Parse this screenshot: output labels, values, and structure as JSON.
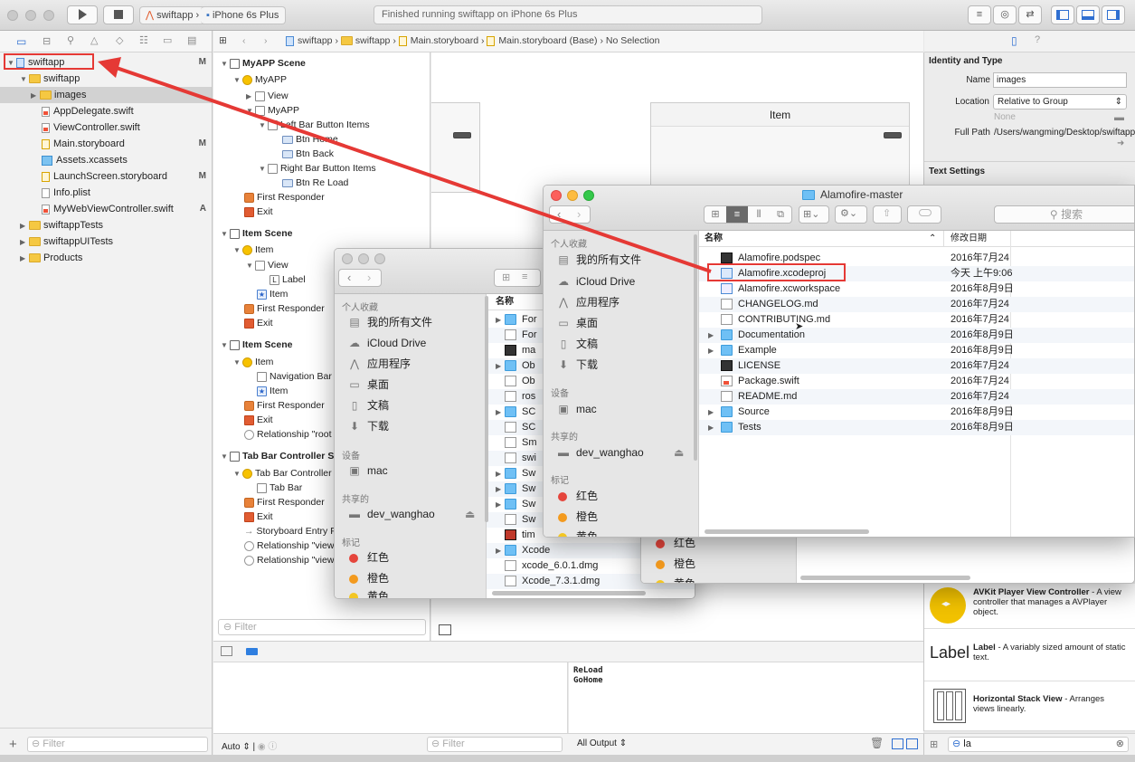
{
  "toolbar": {
    "scheme": "swiftapp",
    "device": "iPhone 6s Plus",
    "status": "Finished running swiftapp on iPhone 6s Plus"
  },
  "jumpbar": {
    "crumbs": [
      "swiftapp",
      "swiftapp",
      "Main.storyboard",
      "Main.storyboard (Base)",
      "No Selection"
    ]
  },
  "navigator": {
    "items": [
      {
        "label": "swiftapp",
        "status": "M"
      },
      {
        "label": "swiftapp",
        "status": ""
      },
      {
        "label": "images",
        "status": ""
      },
      {
        "label": "AppDelegate.swift",
        "status": ""
      },
      {
        "label": "ViewController.swift",
        "status": ""
      },
      {
        "label": "Main.storyboard",
        "status": "M"
      },
      {
        "label": "Assets.xcassets",
        "status": ""
      },
      {
        "label": "LaunchScreen.storyboard",
        "status": "M"
      },
      {
        "label": "Info.plist",
        "status": ""
      },
      {
        "label": "MyWebViewController.swift",
        "status": "A"
      },
      {
        "label": "swiftappTests",
        "status": ""
      },
      {
        "label": "swiftappUITests",
        "status": ""
      },
      {
        "label": "Products",
        "status": ""
      }
    ],
    "filter_placeholder": "Filter"
  },
  "outline": {
    "rows": [
      "MyAPP Scene",
      "MyAPP",
      "View",
      "MyAPP",
      "Left Bar Button Items",
      "Btn Home",
      "Btn Back",
      "Right Bar Button Items",
      "Btn Re Load",
      "First Responder",
      "Exit",
      "Item Scene",
      "Item",
      "View",
      "Label",
      "Item",
      "First Responder",
      "Exit",
      "Item Scene",
      "Item",
      "Navigation Bar",
      "Item",
      "First Responder",
      "Exit",
      "Relationship \"root v",
      "Tab Bar Controller S",
      "Tab Bar Controller",
      "Tab Bar",
      "First Responder",
      "Exit",
      "Storyboard Entry P",
      "Relationship \"view",
      "Relationship \"view"
    ],
    "filter_placeholder": "Filter"
  },
  "canvas": {
    "item_title": "Item"
  },
  "inspector": {
    "section_identity": "Identity and Type",
    "name_label": "Name",
    "name_value": "images",
    "location_label": "Location",
    "location_value": "Relative to Group",
    "none_text": "None",
    "fullpath_label": "Full Path",
    "fullpath_value": "/Users/wangming/Desktop/swiftapp/swiftapp",
    "section_text": "Text Settings"
  },
  "library": {
    "items": [
      {
        "title": "AVKit Player View Controller",
        "desc": "A view controller that manages a AVPlayer object."
      },
      {
        "title": "Label",
        "desc": "A variably sized amount of static text.",
        "thumb": "Label"
      },
      {
        "title": "Horizontal Stack View",
        "desc": "Arranges views linearly."
      }
    ],
    "search_value": "la"
  },
  "debug": {
    "output_lines": [
      "ReLoad",
      "GoHome"
    ],
    "auto_label": "Auto",
    "output_select": "All Output",
    "filter_placeholder": "Filter"
  },
  "finder_back": {
    "sidebar": {
      "favorites_header": "个人收藏",
      "favorites": [
        "我的所有文件",
        "iCloud Drive",
        "应用程序",
        "桌面",
        "文稿",
        "下载"
      ],
      "devices_header": "设备",
      "devices": [
        "mac"
      ],
      "shared_header": "共享的",
      "shared": [
        "dev_wanghao"
      ],
      "tags_header": "标记",
      "tags": [
        "红色",
        "橙色",
        "黄色"
      ]
    },
    "column_name": "名称",
    "files": [
      "For",
      "For",
      "ma",
      "Ob",
      "Ob",
      "ros",
      "SC",
      "SC",
      "Sm",
      "swi",
      "Sw",
      "Sw",
      "Sw",
      "Sw",
      "tim",
      "Xcode",
      "xcode_6.0.1.dmg",
      "Xcode_7.3.1.dmg"
    ]
  },
  "finder_mid": {
    "tags": [
      "红色",
      "橙色",
      "黄色"
    ]
  },
  "finder_front": {
    "title": "Alamofire-master",
    "search_placeholder": "搜索",
    "sidebar": {
      "favorites_header": "个人收藏",
      "favorites": [
        "我的所有文件",
        "iCloud Drive",
        "应用程序",
        "桌面",
        "文稿",
        "下载"
      ],
      "devices_header": "设备",
      "devices": [
        "mac"
      ],
      "shared_header": "共享的",
      "shared": [
        "dev_wanghao"
      ],
      "tags_header": "标记",
      "tags": [
        "红色",
        "橙色",
        "黄色"
      ]
    },
    "col_name": "名称",
    "col_date": "修改日期",
    "files": [
      {
        "name": "Alamofire.podspec",
        "date": "2016年7月24"
      },
      {
        "name": "Alamofire.xcodeproj",
        "date": "今天 上午9:06"
      },
      {
        "name": "Alamofire.xcworkspace",
        "date": "2016年8月9日"
      },
      {
        "name": "CHANGELOG.md",
        "date": "2016年7月24"
      },
      {
        "name": "CONTRIBUTING.md",
        "date": "2016年7月24"
      },
      {
        "name": "Documentation",
        "date": "2016年8月9日"
      },
      {
        "name": "Example",
        "date": "2016年8月9日"
      },
      {
        "name": "LICENSE",
        "date": "2016年7月24"
      },
      {
        "name": "Package.swift",
        "date": "2016年7月24"
      },
      {
        "name": "README.md",
        "date": "2016年7月24"
      },
      {
        "name": "Source",
        "date": "2016年8月9日"
      },
      {
        "name": "Tests",
        "date": "2016年8月9日"
      }
    ]
  },
  "colors": {
    "highlight": "#e53935",
    "tag_red": "#e5453c",
    "tag_orange": "#f39a1e",
    "tag_yellow": "#f3c623",
    "folder_blue": "#6fc0f5"
  }
}
